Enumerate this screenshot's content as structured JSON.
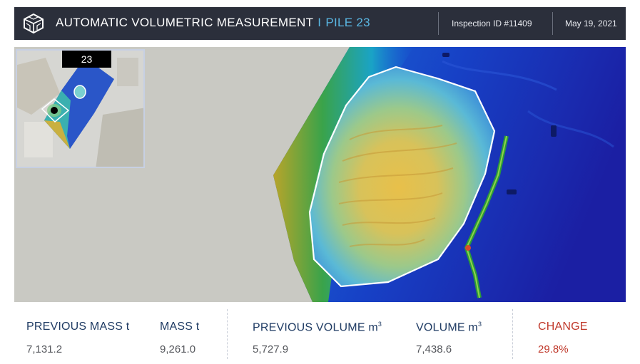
{
  "header": {
    "title": "AUTOMATIC VOLUMETRIC MEASUREMENT",
    "separator": "I",
    "pile": "PILE 23",
    "inspection_id": "Inspection ID #11409",
    "date": "May 19, 2021",
    "logo_icon": "hexagon-cube-logo-icon"
  },
  "inset": {
    "pile_label": "23"
  },
  "metrics": {
    "previous_mass": {
      "label": "PREVIOUS MASS t",
      "value": "7,131.2"
    },
    "mass": {
      "label": "MASS t",
      "value": "9,261.0"
    },
    "previous_volume": {
      "label": "PREVIOUS VOLUME m",
      "unit_sup": "3",
      "value": "5,727.9"
    },
    "volume": {
      "label": "VOLUME m",
      "unit_sup": "3",
      "value": "7,438.6"
    },
    "change": {
      "label": "CHANGE",
      "value": "29.8%"
    }
  },
  "colors": {
    "header_bg": "#2b2f3b",
    "accent_blue": "#5ab7e3",
    "metric_label": "#1f3b63",
    "change_red": "#c0392b"
  }
}
